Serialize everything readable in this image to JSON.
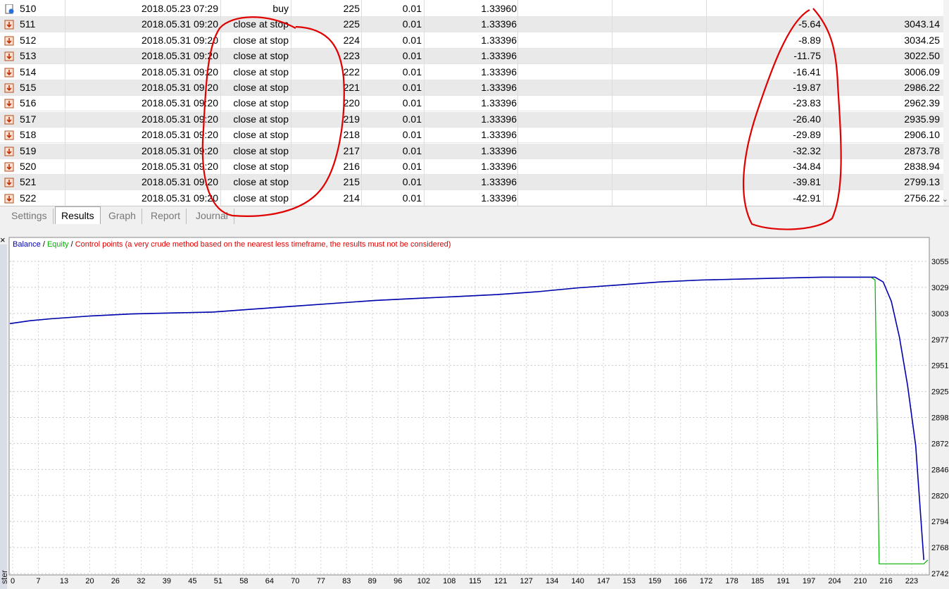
{
  "table": {
    "rows": [
      {
        "id": "510",
        "time": "2018.05.23 07:29",
        "type": "buy",
        "order": "225",
        "size": "0.01",
        "price": "1.33960",
        "profit": "",
        "balance": "",
        "icon": "buy-order-icon"
      },
      {
        "id": "511",
        "time": "2018.05.31 09:20",
        "type": "close at stop",
        "order": "225",
        "size": "0.01",
        "price": "1.33396",
        "profit": "-5.64",
        "balance": "3043.14",
        "icon": "close-order-icon"
      },
      {
        "id": "512",
        "time": "2018.05.31 09:20",
        "type": "close at stop",
        "order": "224",
        "size": "0.01",
        "price": "1.33396",
        "profit": "-8.89",
        "balance": "3034.25",
        "icon": "close-order-icon"
      },
      {
        "id": "513",
        "time": "2018.05.31 09:20",
        "type": "close at stop",
        "order": "223",
        "size": "0.01",
        "price": "1.33396",
        "profit": "-11.75",
        "balance": "3022.50",
        "icon": "close-order-icon"
      },
      {
        "id": "514",
        "time": "2018.05.31 09:20",
        "type": "close at stop",
        "order": "222",
        "size": "0.01",
        "price": "1.33396",
        "profit": "-16.41",
        "balance": "3006.09",
        "icon": "close-order-icon"
      },
      {
        "id": "515",
        "time": "2018.05.31 09:20",
        "type": "close at stop",
        "order": "221",
        "size": "0.01",
        "price": "1.33396",
        "profit": "-19.87",
        "balance": "2986.22",
        "icon": "close-order-icon"
      },
      {
        "id": "516",
        "time": "2018.05.31 09:20",
        "type": "close at stop",
        "order": "220",
        "size": "0.01",
        "price": "1.33396",
        "profit": "-23.83",
        "balance": "2962.39",
        "icon": "close-order-icon"
      },
      {
        "id": "517",
        "time": "2018.05.31 09:20",
        "type": "close at stop",
        "order": "219",
        "size": "0.01",
        "price": "1.33396",
        "profit": "-26.40",
        "balance": "2935.99",
        "icon": "close-order-icon"
      },
      {
        "id": "518",
        "time": "2018.05.31 09:20",
        "type": "close at stop",
        "order": "218",
        "size": "0.01",
        "price": "1.33396",
        "profit": "-29.89",
        "balance": "2906.10",
        "icon": "close-order-icon"
      },
      {
        "id": "519",
        "time": "2018.05.31 09:20",
        "type": "close at stop",
        "order": "217",
        "size": "0.01",
        "price": "1.33396",
        "profit": "-32.32",
        "balance": "2873.78",
        "icon": "close-order-icon"
      },
      {
        "id": "520",
        "time": "2018.05.31 09:20",
        "type": "close at stop",
        "order": "216",
        "size": "0.01",
        "price": "1.33396",
        "profit": "-34.84",
        "balance": "2838.94",
        "icon": "close-order-icon"
      },
      {
        "id": "521",
        "time": "2018.05.31 09:20",
        "type": "close at stop",
        "order": "215",
        "size": "0.01",
        "price": "1.33396",
        "profit": "-39.81",
        "balance": "2799.13",
        "icon": "close-order-icon"
      },
      {
        "id": "522",
        "time": "2018.05.31 09:20",
        "type": "close at stop",
        "order": "214",
        "size": "0.01",
        "price": "1.33396",
        "profit": "-42.91",
        "balance": "2756.22",
        "icon": "close-order-icon"
      }
    ]
  },
  "tabs": [
    "Settings",
    "Results",
    "Graph",
    "Report",
    "Journal"
  ],
  "active_tab": "Results",
  "close_icon": "×",
  "sidebar_label": "ster",
  "colors": {
    "balance": "#0000b0",
    "equity": "#00b000",
    "control": "#e00000",
    "annotation": "#e00000"
  },
  "chart_data": {
    "type": "line",
    "legend": {
      "balance": "Balance",
      "sep1": " / ",
      "equity": "Equity",
      "sep2": " / ",
      "control": "Control points (a very crude method based on the nearest less timeframe, the results must not be considered)"
    },
    "x_ticks": [
      "0",
      "7",
      "13",
      "20",
      "26",
      "32",
      "39",
      "45",
      "51",
      "58",
      "64",
      "70",
      "77",
      "83",
      "89",
      "96",
      "102",
      "108",
      "115",
      "121",
      "127",
      "134",
      "140",
      "147",
      "153",
      "159",
      "166",
      "172",
      "178",
      "185",
      "191",
      "197",
      "204",
      "210",
      "216",
      "223"
    ],
    "y_ticks": [
      "3055",
      "3029",
      "3003",
      "2977",
      "2951",
      "2925",
      "2898",
      "2872",
      "2846",
      "2820",
      "2794",
      "2768",
      "2742"
    ],
    "xlim": [
      0,
      226
    ],
    "ylim": [
      2742,
      3065
    ],
    "series": [
      {
        "name": "Balance",
        "x": [
          0,
          5,
          10,
          20,
          30,
          40,
          50,
          60,
          70,
          80,
          90,
          100,
          110,
          120,
          130,
          140,
          150,
          160,
          170,
          180,
          190,
          200,
          213,
          215,
          217,
          219,
          221,
          223,
          225
        ],
        "y": [
          3000,
          3003,
          3005,
          3008,
          3010,
          3011,
          3012,
          3015,
          3018,
          3021,
          3024,
          3026,
          3028,
          3030,
          3033,
          3037,
          3040,
          3043,
          3045,
          3046,
          3047,
          3048,
          3048,
          3043,
          3023,
          2986,
          2936,
          2874,
          2756
        ]
      },
      {
        "name": "Equity",
        "x": [
          0,
          5,
          10,
          20,
          30,
          40,
          50,
          60,
          70,
          80,
          90,
          100,
          110,
          120,
          130,
          140,
          150,
          160,
          170,
          180,
          190,
          200,
          212,
          213,
          214,
          225,
          226
        ],
        "y": [
          3000,
          3003,
          3005,
          3008,
          3010,
          3011,
          3012,
          3015,
          3018,
          3021,
          3024,
          3026,
          3028,
          3030,
          3033,
          3037,
          3040,
          3043,
          3045,
          3046,
          3047,
          3048,
          3048,
          3045,
          2752,
          2752,
          2756
        ]
      }
    ]
  }
}
